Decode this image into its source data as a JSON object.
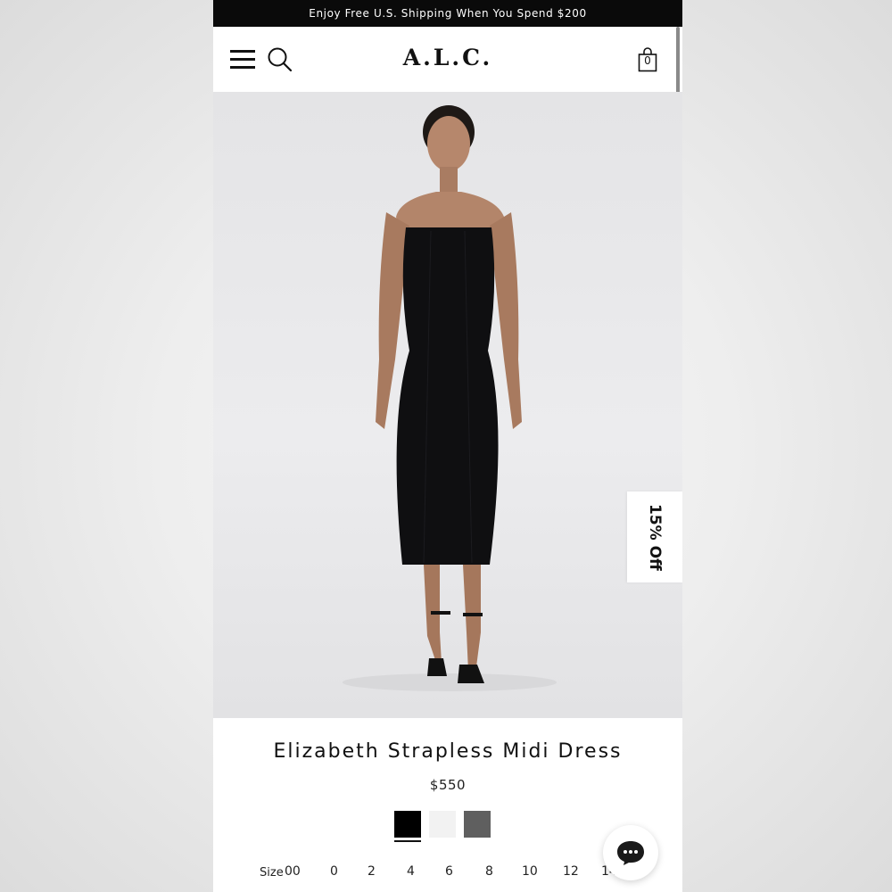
{
  "promo": {
    "text": "Enjoy Free U.S. Shipping When You Spend $200"
  },
  "header": {
    "logo": "A.L.C.",
    "bag_count": "0",
    "icons": {
      "menu": "hamburger-menu-icon",
      "search": "search-icon",
      "bag": "shopping-bag-icon"
    }
  },
  "hero": {
    "discount_tab": "15% Off"
  },
  "product": {
    "title": "Elizabeth Strapless Midi Dress",
    "price": "$550",
    "swatches": [
      {
        "color": "#000000",
        "selected": true
      },
      {
        "color": "#f2f2f2",
        "selected": false
      },
      {
        "color": "#5f5f5f",
        "selected": false
      }
    ],
    "size_label": "Size",
    "sizes": [
      "00",
      "0",
      "2",
      "4",
      "6",
      "8",
      "10",
      "12",
      "14"
    ]
  },
  "chat": {
    "icon": "chat-bubble-icon"
  },
  "colors": {
    "promo_bg": "#0a0a0a",
    "text": "#111111",
    "background": "#ffffff"
  }
}
